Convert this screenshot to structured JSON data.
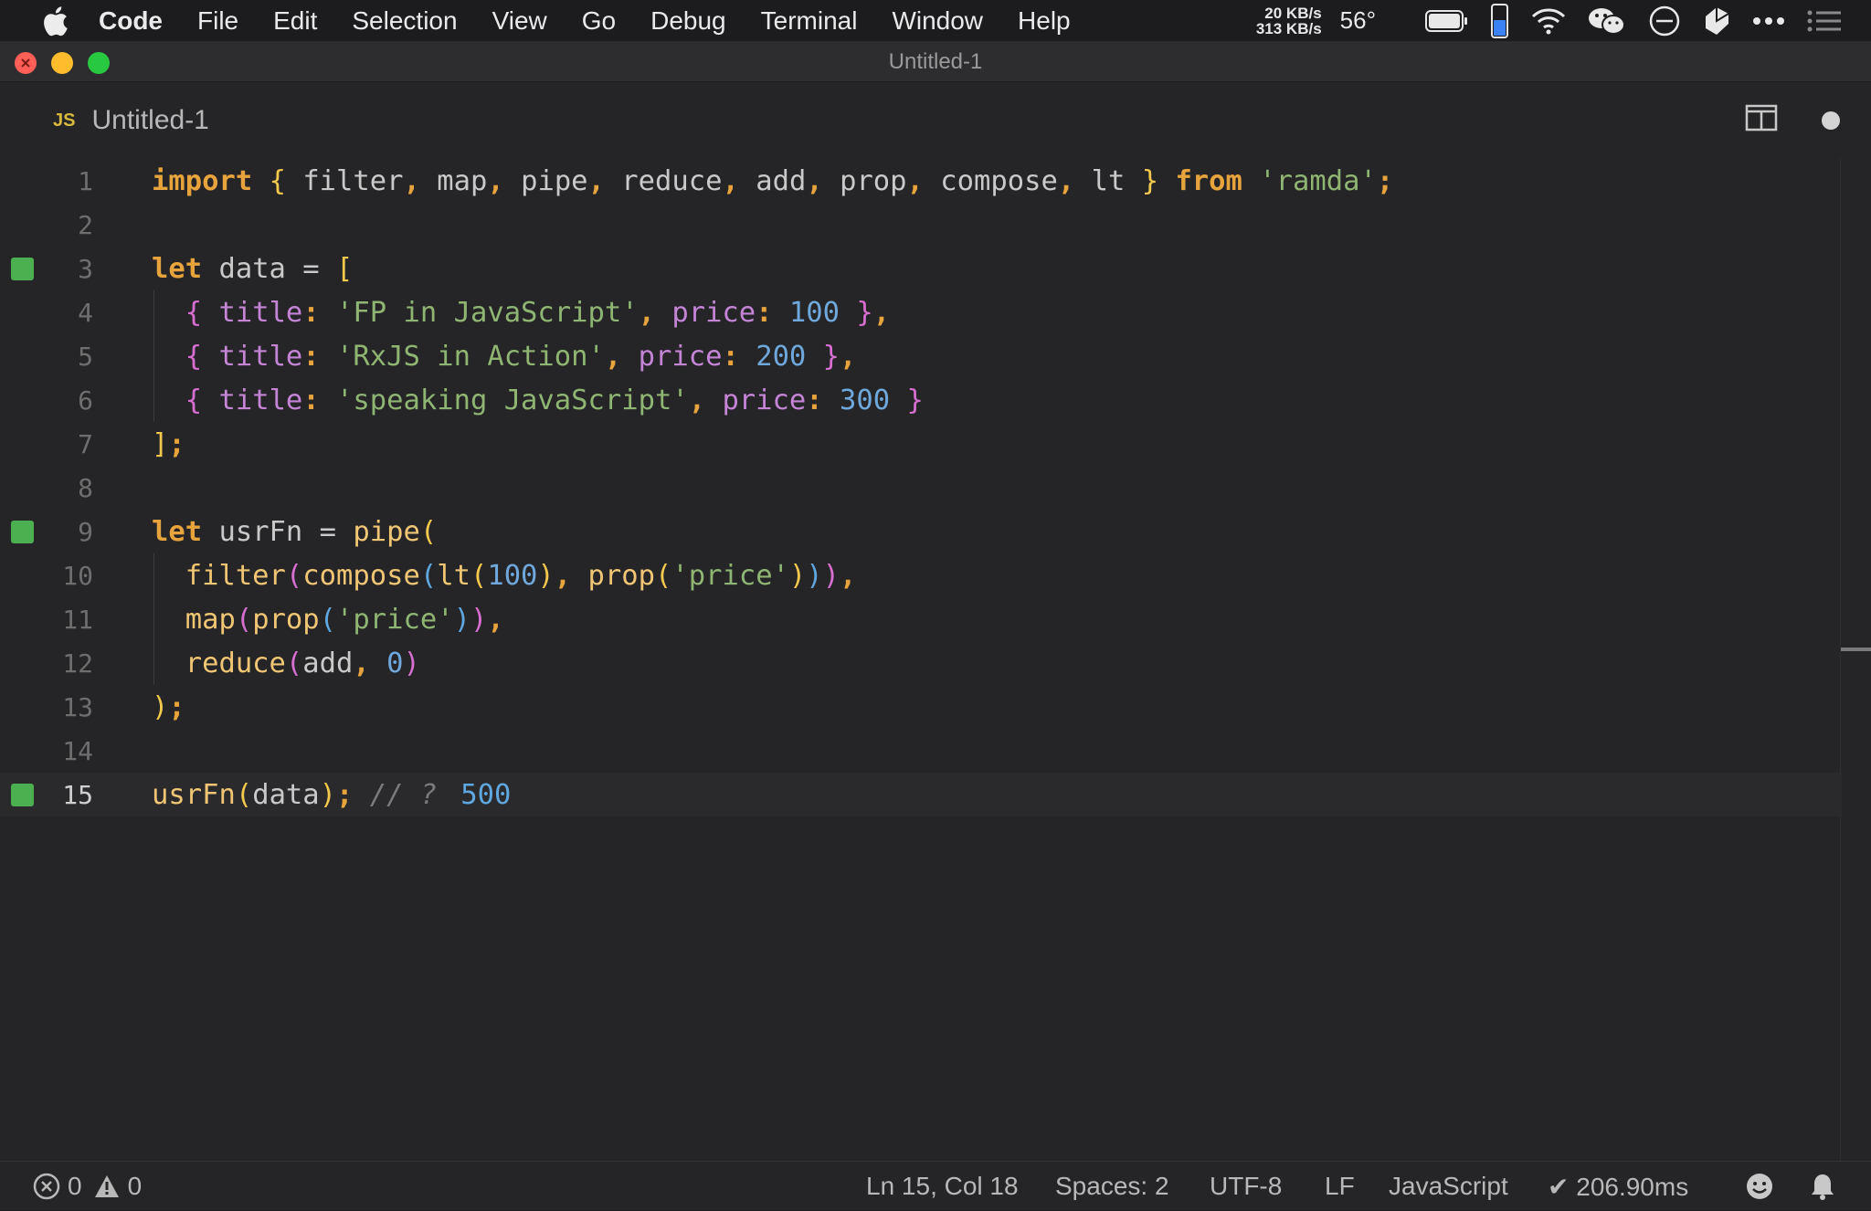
{
  "menubar": {
    "app_name": "Code",
    "items": [
      "File",
      "Edit",
      "Selection",
      "View",
      "Go",
      "Debug",
      "Terminal",
      "Window",
      "Help"
    ],
    "net_up": "20 KB/s",
    "net_down": "313 KB/s",
    "temperature": "56°",
    "icons": [
      "apple-icon",
      "battery-icon",
      "phone-icon",
      "wifi-icon",
      "wechat-icon",
      "do-not-disturb-icon",
      "extension-icon",
      "more-icon",
      "notification-list-icon"
    ]
  },
  "window": {
    "title": "Untitled-1"
  },
  "tab": {
    "icon_text": "JS",
    "label": "Untitled-1",
    "dirty": true
  },
  "editor": {
    "current_line": 15,
    "line_numbers": [
      "1",
      "2",
      "3",
      "4",
      "5",
      "6",
      "7",
      "8",
      "9",
      "10",
      "11",
      "12",
      "13",
      "14",
      "15"
    ],
    "gutter_marks": [
      3,
      9,
      15
    ],
    "quokka_result": "500"
  },
  "statusbar": {
    "errors": "0",
    "warnings": "0",
    "position": "Ln 15, Col 18",
    "spaces": "Spaces: 2",
    "encoding": "UTF-8",
    "eol": "LF",
    "language": "JavaScript",
    "timing": "✔ 206.90ms"
  },
  "colors": {
    "keyword": "#e8a43c",
    "function": "#f0c674",
    "property": "#c585d6",
    "string": "#8fb573",
    "number": "#6fa8dc",
    "gutter_mark": "#4caf50"
  }
}
